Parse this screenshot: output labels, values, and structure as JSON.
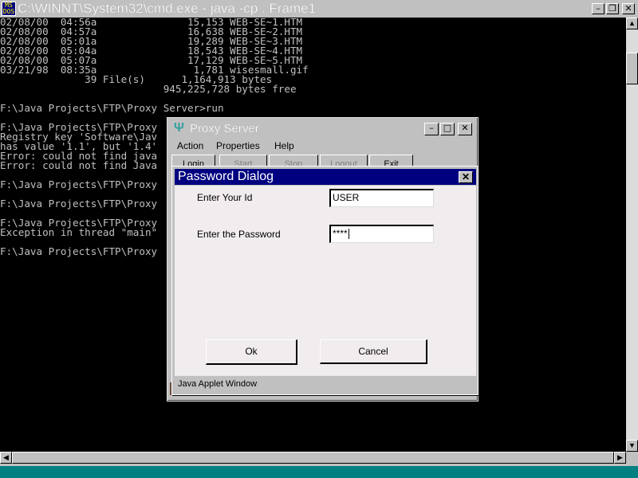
{
  "console_window": {
    "title": "C:\\WINNT\\System32\\cmd.exe - java -cp . Frame1",
    "icon_text": "MS\nDOS",
    "lines": [
      "02/08/00  04:56a               15,153 WEB-SE~1.HTM",
      "02/08/00  04:57a               16,638 WEB-SE~2.HTM",
      "02/08/00  05:01a               19,289 WEB-SE~3.HTM",
      "02/08/00  05:04a               18,543 WEB-SE~4.HTM",
      "02/08/00  05:07a               17,129 WEB-SE~5.HTM",
      "03/21/98  08:35a                1,781 wisesmall.gif",
      "              39 File(s)      1,164,913 bytes",
      "                           945,225,728 bytes free",
      "",
      "F:\\Java Projects\\FTP\\Proxy Server>run",
      "",
      "F:\\Java Projects\\FTP\\Proxy",
      "Registry key 'Software\\Jav",
      "has value '1.1', but '1.4'",
      "Error: could not find java",
      "Error: could not find Java",
      "",
      "F:\\Java Projects\\FTP\\Proxy",
      "",
      "F:\\Java Projects\\FTP\\Proxy",
      "",
      "F:\\Java Projects\\FTP\\Proxy",
      "Exception in thread \"main\"",
      "",
      "F:\\Java Projects\\FTP\\Proxy"
    ]
  },
  "proxy_window": {
    "title": "Proxy Server",
    "menu": [
      "Action",
      "Properties",
      "Help"
    ],
    "tabs": [
      "Login",
      "Start",
      "Stop",
      "Logout",
      "Exit"
    ]
  },
  "password_dialog": {
    "title": "Password Dialog",
    "id_label": "Enter Your Id",
    "id_value": "USER",
    "password_label": "Enter the Password",
    "password_value": "****",
    "ok_label": "Ok",
    "cancel_label": "Cancel",
    "status_text": "Java Applet Window"
  }
}
